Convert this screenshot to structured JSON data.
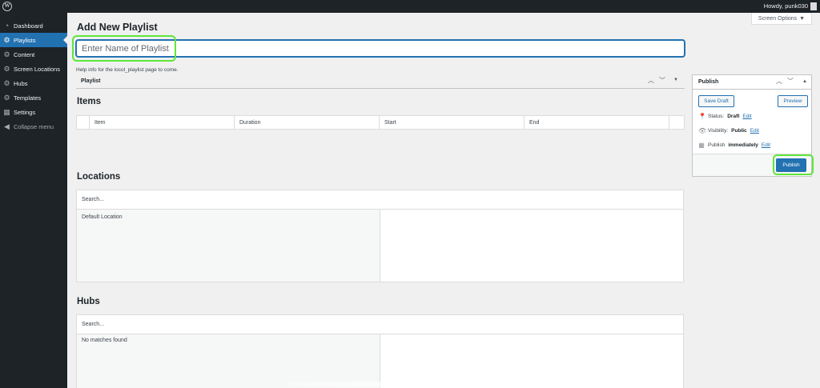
{
  "adminbar": {
    "howdy": "Howdy, punk030"
  },
  "sidebar": {
    "items": [
      {
        "label": "Dashboard",
        "icon": "dashboard-icon"
      },
      {
        "label": "Playlists",
        "icon": "gear-icon",
        "active": true
      },
      {
        "label": "Content",
        "icon": "gear-icon"
      },
      {
        "label": "Screen Locations",
        "icon": "gear-icon"
      },
      {
        "label": "Hubs",
        "icon": "gear-icon"
      },
      {
        "label": "Templates",
        "icon": "gear-icon"
      },
      {
        "label": "Settings",
        "icon": "settings-icon"
      },
      {
        "label": "Collapse menu",
        "icon": "collapse-icon"
      }
    ]
  },
  "screen_options": {
    "label": "Screen Options"
  },
  "page": {
    "title": "Add New Playlist",
    "title_placeholder": "Enter Name of Playlist",
    "help_text": "Help info for the locol_playlist page to come."
  },
  "playlist_box": {
    "title": "Playlist"
  },
  "items": {
    "title": "Items",
    "columns": [
      "Item",
      "Duration",
      "Start",
      "End"
    ]
  },
  "locations": {
    "title": "Locations",
    "search_placeholder": "Search...",
    "available": [
      "Default Location"
    ]
  },
  "hubs": {
    "title": "Hubs",
    "search_placeholder": "Search...",
    "empty_text": "No matches found"
  },
  "publish": {
    "title": "Publish",
    "save_draft": "Save Draft",
    "preview": "Preview",
    "status_label": "Status:",
    "status_value": "Draft",
    "visibility_label": "Visibility:",
    "visibility_value": "Public",
    "publish_label": "Publish",
    "publish_value": "immediately",
    "edit": "Edit",
    "publish_button": "Publish"
  },
  "colors": {
    "accent": "#2271b1",
    "sidebar": "#1d2327",
    "highlight": "#5fe63a"
  }
}
